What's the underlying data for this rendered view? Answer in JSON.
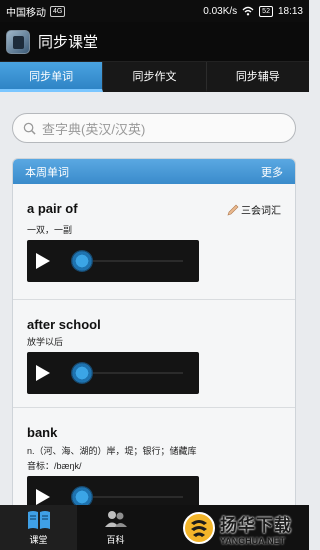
{
  "status_bar": {
    "carrier": "中国移动",
    "sim_badge": "4G",
    "speed": "0.03K/s",
    "battery": "52",
    "time": "18:13"
  },
  "app_bar": {
    "title": "同步课堂"
  },
  "tabs": [
    {
      "label": "同步单词",
      "active": true
    },
    {
      "label": "同步作文",
      "active": false
    },
    {
      "label": "同步辅导",
      "active": false
    }
  ],
  "search": {
    "placeholder": "查字典(英汉/汉英)"
  },
  "weekly_words": {
    "title": "本周单词",
    "more_label": "更多",
    "entries": [
      {
        "word": "a pair of",
        "meaning": "一双，一副",
        "phonetic": "",
        "tag": "三会词汇"
      },
      {
        "word": "after school",
        "meaning": "放学以后",
        "phonetic": "",
        "tag": ""
      },
      {
        "word": "bank",
        "meaning": "n.（河、海、湖的）岸，堤；银行；储藏库",
        "phonetic": "音标：/bæŋk/",
        "tag": ""
      }
    ]
  },
  "bottom_nav": [
    {
      "label": "课堂",
      "icon": "book-icon",
      "active": true
    },
    {
      "label": "百科",
      "icon": "people-icon",
      "active": false
    }
  ],
  "watermark": {
    "cn": "扬华下载",
    "en": "YANGHUA.NET"
  },
  "colors": {
    "accent": "#3a8bcb",
    "tab_active": "#2f84c6",
    "bar": "#0b0b0b"
  }
}
